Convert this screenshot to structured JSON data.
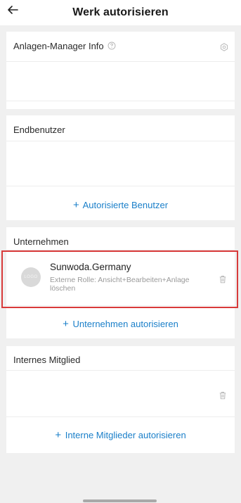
{
  "header": {
    "title": "Werk autorisieren",
    "back_icon": "arrow-left-icon"
  },
  "manager_info": {
    "label": "Anlagen-Manager Info",
    "help_icon": "question-circle-icon",
    "settings_icon": "gear-icon"
  },
  "end_users": {
    "label": "Endbenutzer",
    "add_link_plus": "+",
    "add_link_text": "Autorisierte Benutzer"
  },
  "companies": {
    "label": "Unternehmen",
    "items": [
      {
        "logo_text": "LOGO",
        "name": "Sunwoda.Germany",
        "role": "Externe Rolle: Ansicht+Bearbeiten+Anlage löschen",
        "delete_icon": "trash-icon"
      }
    ],
    "add_link_plus": "+",
    "add_link_text": "Unternehmen autorisieren"
  },
  "internal_members": {
    "label": "Internes Mitglied",
    "delete_icon": "trash-icon",
    "add_link_plus": "+",
    "add_link_text": "Interne Mitglieder autorisieren"
  },
  "colors": {
    "accent": "#1a7fc9",
    "highlight_border": "#d83a3a",
    "background": "#f0f0f0"
  }
}
